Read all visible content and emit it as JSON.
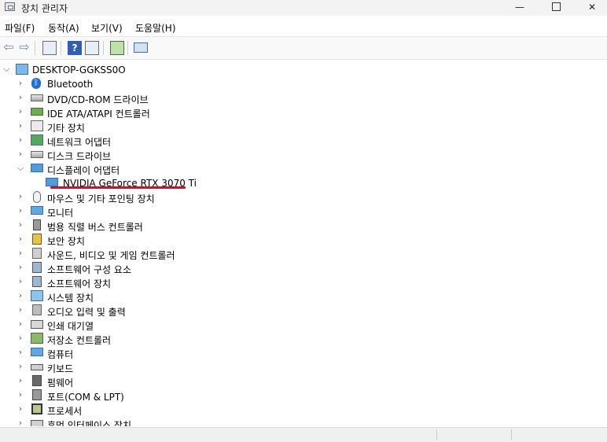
{
  "window": {
    "title": "장치 관리자",
    "min": "—",
    "close": "✕"
  },
  "menu": [
    "파일(F)",
    "동작(A)",
    "보기(V)",
    "도움말(H)"
  ],
  "toolbar": {
    "buttons": [
      "back-icon",
      "forward-icon",
      "properties-icon",
      "help-icon",
      "view-icon",
      "scan-icon",
      "monitor-icon"
    ]
  },
  "tree": {
    "root": "DESKTOP-GGKSS0O",
    "items": [
      "Bluetooth",
      "DVD/CD-ROM 드라이브",
      "IDE ATA/ATAPI 컨트롤러",
      "기타 장치",
      "네트워크 어댑터",
      "디스크 드라이브",
      "디스플레이 어댑터",
      "NVIDIA GeForce RTX 3070 Ti",
      "마우스 및 기타 포인팅 장치",
      "모니터",
      "범용 직렬 버스 컨트롤러",
      "보안 장치",
      "사운드, 비디오 및 게임 컨트롤러",
      "소프트웨어 구성 요소",
      "소프트웨어 장치",
      "시스템 장치",
      "오디오 입력 및 출력",
      "인쇄 대기열",
      "저장소 컨트롤러",
      "컴퓨터",
      "키보드",
      "펌웨어",
      "포트(COM & LPT)",
      "프로세서",
      "휴먼 인터페이스 장치"
    ]
  },
  "colors": {
    "highlight_underline": "#d0102a",
    "accent": "#3a6fa8"
  }
}
